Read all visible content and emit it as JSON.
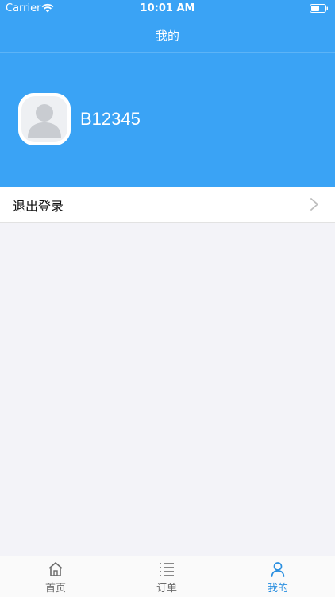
{
  "status_bar": {
    "carrier": "Carrier",
    "time": "10:01 AM"
  },
  "nav": {
    "title": "我的"
  },
  "profile": {
    "username": "B12345"
  },
  "menu": {
    "logout_label": "退出登录"
  },
  "tabs": [
    {
      "label": "首页",
      "icon": "home-icon",
      "active": false
    },
    {
      "label": "订单",
      "icon": "list-icon",
      "active": false
    },
    {
      "label": "我的",
      "icon": "person-icon",
      "active": true
    }
  ],
  "colors": {
    "primary": "#3aa3f5",
    "tab_active": "#2a8fe0",
    "tab_inactive": "#6b6b6b",
    "background": "#f3f3f8"
  }
}
